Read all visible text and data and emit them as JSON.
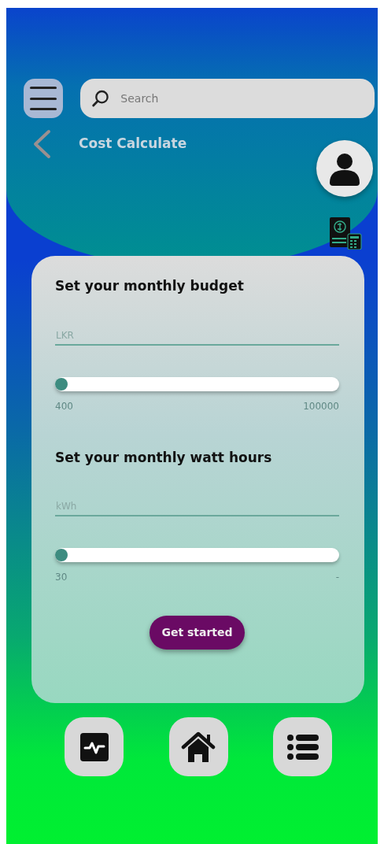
{
  "search": {
    "placeholder": "Search"
  },
  "header": {
    "title": "Cost Calculate"
  },
  "sections": [
    {
      "heading": "Set your monthly budget",
      "field": {
        "placeholder": "LKR"
      },
      "slider": {
        "level": 0,
        "min_label": "400",
        "max_label": "100000"
      }
    },
    {
      "heading": "Set your monthly watt hours",
      "field": {
        "placeholder": "kWh"
      },
      "slider": {
        "level": 0,
        "min_label": "30",
        "max_label": "-"
      }
    }
  ],
  "button": {
    "label": "Get started"
  },
  "bottom_nav": [
    {
      "kind": "activity"
    },
    {
      "kind": "home"
    },
    {
      "kind": "list"
    }
  ]
}
